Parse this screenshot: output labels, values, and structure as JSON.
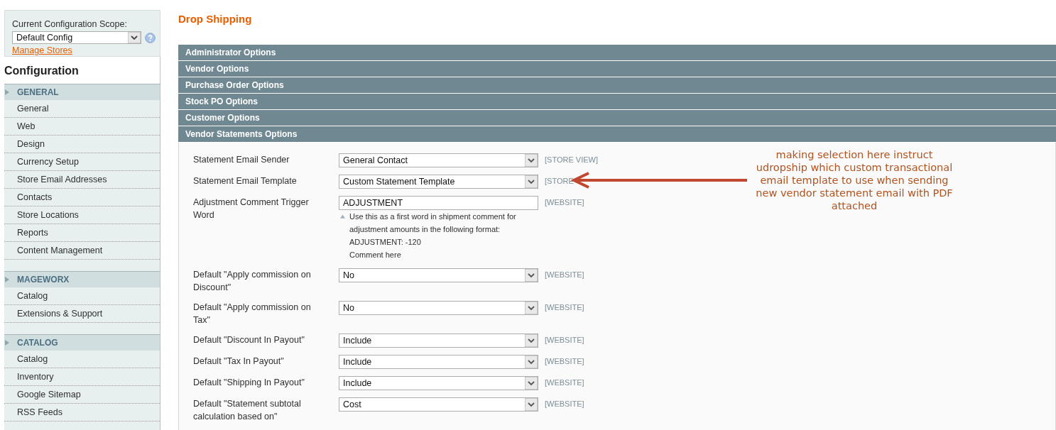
{
  "scope_switcher": {
    "label": "Current Configuration Scope:",
    "value": "Default Config",
    "link": "Manage Stores"
  },
  "sidebar": {
    "title": "Configuration",
    "groups": [
      {
        "title": "GENERAL",
        "items": [
          "General",
          "Web",
          "Design",
          "Currency Setup",
          "Store Email Addresses",
          "Contacts",
          "Store Locations",
          "Reports",
          "Content Management"
        ]
      },
      {
        "title": "MAGEWORX",
        "items": [
          "Catalog",
          "Extensions & Support"
        ]
      },
      {
        "title": "CATALOG",
        "items": [
          "Catalog",
          "Inventory",
          "Google Sitemap",
          "RSS Feeds"
        ]
      }
    ]
  },
  "page": {
    "title": "Drop Shipping"
  },
  "sections": [
    {
      "title": "Administrator Options"
    },
    {
      "title": "Vendor Options"
    },
    {
      "title": "Purchase Order Options"
    },
    {
      "title": "Stock PO Options"
    },
    {
      "title": "Customer Options"
    },
    {
      "title": "Vendor Statements Options",
      "fields": [
        {
          "kind": "select",
          "label": "Statement Email Sender",
          "value": "General Contact",
          "scope": "[STORE VIEW]"
        },
        {
          "kind": "select",
          "label": "Statement Email Template",
          "value": "Custom Statement Template",
          "scope": "[STORE"
        },
        {
          "kind": "text",
          "label": "Adjustment Comment Trigger Word",
          "value": "ADJUSTMENT",
          "scope": "[WEBSITE]",
          "hint": "Use this as a first word in shipment comment for adjustment amounts in the following format:\nADJUSTMENT: -120\nComment here"
        },
        {
          "kind": "select",
          "label": "Default \"Apply commission on Discount\"",
          "value": "No",
          "scope": "[WEBSITE]"
        },
        {
          "kind": "select",
          "label": "Default \"Apply commission on Tax\"",
          "value": "No",
          "scope": "[WEBSITE]"
        },
        {
          "kind": "select",
          "label": "Default \"Discount In Payout\"",
          "value": "Include",
          "scope": "[WEBSITE]"
        },
        {
          "kind": "select",
          "label": "Default \"Tax In Payout\"",
          "value": "Include",
          "scope": "[WEBSITE]"
        },
        {
          "kind": "select",
          "label": "Default \"Shipping In Payout\"",
          "value": "Include",
          "scope": "[WEBSITE]"
        },
        {
          "kind": "select",
          "label": "Default \"Statement subtotal calculation based on\"",
          "value": "Cost",
          "scope": "[WEBSITE]"
        }
      ]
    }
  ],
  "annotation": {
    "text": "making selection here instruct udropship which custom transactional email template to use when sending new vendor statement email with PDF attached"
  }
}
